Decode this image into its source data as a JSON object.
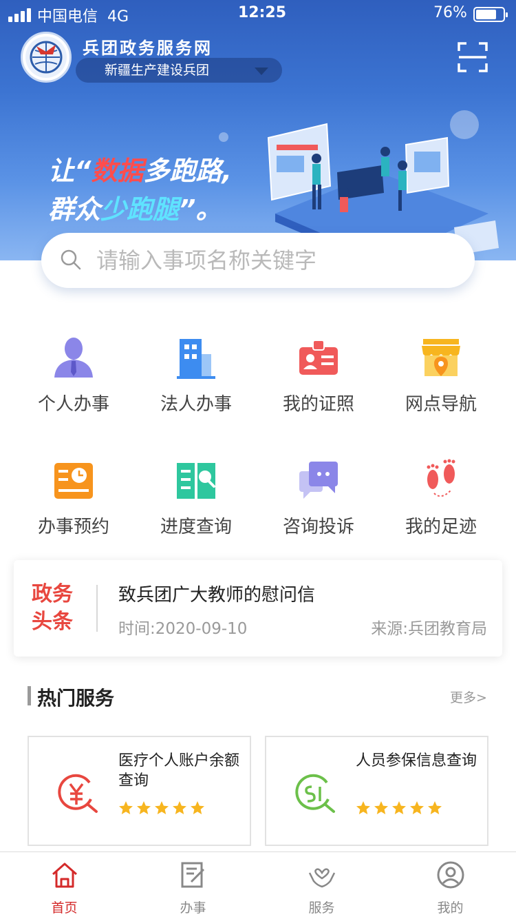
{
  "status_bar": {
    "carrier": "中国电信",
    "network": "4G",
    "time": "12:25",
    "battery": "76%",
    "battery_level": 0.76
  },
  "header": {
    "app_title": "兵团政务服务网",
    "region": "新疆生产建设兵团",
    "slogan_line1": [
      "让“",
      "数据",
      "多跑路,"
    ],
    "slogan_line2": [
      "群众",
      "少跑腿",
      "”。"
    ]
  },
  "search": {
    "placeholder": "请输入事项名称关键字"
  },
  "services": [
    {
      "label": "个人办事",
      "icon": "person-icon",
      "color": "#8b86e8"
    },
    {
      "label": "法人办事",
      "icon": "building-icon",
      "color": "#3d8cf0"
    },
    {
      "label": "我的证照",
      "icon": "id-card-icon",
      "color": "#f05a5a"
    },
    {
      "label": "网点导航",
      "icon": "store-location-icon",
      "color": "#f7b51f"
    },
    {
      "label": "办事预约",
      "icon": "calendar-clock-icon",
      "color": "#f7941d"
    },
    {
      "label": "进度查询",
      "icon": "book-search-icon",
      "color": "#2ec79e"
    },
    {
      "label": "咨询投诉",
      "icon": "chat-bubble-icon",
      "color": "#8b86e8"
    },
    {
      "label": "我的足迹",
      "icon": "footprints-icon",
      "color": "#f05a5a"
    }
  ],
  "news": {
    "tag_line1": "政务",
    "tag_line2": "头条",
    "title": "致兵团广大教师的慰问信",
    "time": "时间:2020-09-10",
    "source": "来源:兵团教育局"
  },
  "hot_services": {
    "title": "热门服务",
    "more": "更多>",
    "items": [
      {
        "title": "医疗个人账户余额查询",
        "icon": "yuan-search-icon",
        "rating": 5
      },
      {
        "title": "人员参保信息查询",
        "icon": "si-search-icon",
        "rating": 5
      }
    ]
  },
  "tabbar": [
    {
      "label": "首页",
      "icon": "home-icon",
      "active": true
    },
    {
      "label": "办事",
      "icon": "document-edit-icon",
      "active": false
    },
    {
      "label": "服务",
      "icon": "heart-hands-icon",
      "active": false
    },
    {
      "label": "我的",
      "icon": "user-circle-icon",
      "active": false
    }
  ],
  "colors": {
    "accent_red": "#d42a2a",
    "banner_blue": "#3c74d2",
    "star": "#f7b51f"
  }
}
